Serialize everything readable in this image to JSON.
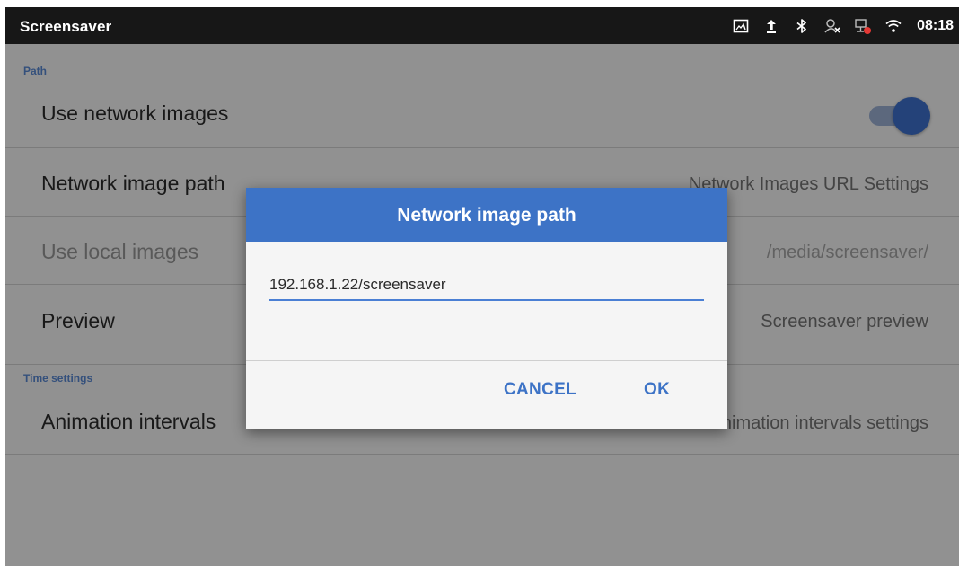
{
  "status_bar": {
    "app_title": "Screensaver",
    "time": "08:18",
    "icons": [
      "screenshot-icon",
      "upload-icon",
      "bluetooth-icon",
      "no-contact-icon",
      "network-error-icon",
      "wifi-icon"
    ]
  },
  "settings": {
    "sections": [
      {
        "header": "Path",
        "items": [
          {
            "title": "Use network images",
            "control": "switch",
            "checked": true
          },
          {
            "title": "Network image path",
            "summary": "Network Images URL Settings"
          },
          {
            "title": "Use local images",
            "summary": "/media/screensaver/",
            "disabled": true
          },
          {
            "title": "Preview",
            "summary": "Screensaver preview"
          }
        ]
      },
      {
        "header": "Time settings",
        "items": [
          {
            "title": "Animation intervals",
            "summary": "Animation intervals settings"
          }
        ]
      }
    ]
  },
  "dialog": {
    "title": "Network image path",
    "input_value": "192.168.1.22/screensaver",
    "cancel_label": "CANCEL",
    "ok_label": "OK"
  },
  "colors": {
    "status_bar": "#171717",
    "accent": "#3d73c6",
    "section_header": "#5b8bd6",
    "switch_thumb": "#3e73d0",
    "switch_track": "#9fb4d8"
  }
}
